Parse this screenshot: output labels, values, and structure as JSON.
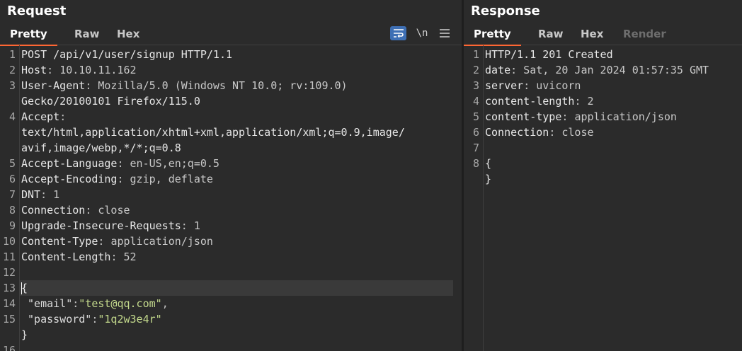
{
  "request": {
    "title": "Request",
    "tabs": [
      "Pretty",
      "Raw",
      "Hex"
    ],
    "active_tab": "Pretty",
    "toolbar": {
      "newline_label": "\\n",
      "wrap_icon": "wrap-lines-icon",
      "menu_icon": "menu-icon"
    },
    "lines": [
      {
        "n": "1",
        "text": "POST /api/v1/user/signup HTTP/1.1"
      },
      {
        "n": "2",
        "key": "Host",
        "value": "10.10.11.162"
      },
      {
        "n": "3",
        "key": "User-Agent",
        "value": "Mozilla/5.0 (Windows NT 10.0; rv:109.0)"
      },
      {
        "n": "",
        "text": "Gecko/20100101 Firefox/115.0"
      },
      {
        "n": "4",
        "key": "Accept",
        "value": ""
      },
      {
        "n": "",
        "text": "text/html,application/xhtml+xml,application/xml;q=0.9,image/"
      },
      {
        "n": "",
        "text": "avif,image/webp,*/*;q=0.8"
      },
      {
        "n": "5",
        "key": "Accept-Language",
        "value": "en-US,en;q=0.5"
      },
      {
        "n": "6",
        "key": "Accept-Encoding",
        "value": "gzip, deflate"
      },
      {
        "n": "7",
        "key": "DNT",
        "value": "1"
      },
      {
        "n": "8",
        "key": "Connection",
        "value": "close"
      },
      {
        "n": "9",
        "key": "Upgrade-Insecure-Requests",
        "value": "1"
      },
      {
        "n": "10",
        "key": "Content-Type",
        "value": "application/json"
      },
      {
        "n": "11",
        "key": "Content-Length",
        "value": "52"
      },
      {
        "n": "12",
        "text": ""
      },
      {
        "n": "13",
        "text": "{",
        "highlight": true
      },
      {
        "n": "14",
        "json_key": "\"email\"",
        "json_value": "\"test@qq.com\"",
        "trail": ","
      },
      {
        "n": "15",
        "json_key": "\"password\"",
        "json_value": "\"1q2w3e4r\"",
        "trail": ""
      },
      {
        "n": "",
        "text": "}"
      },
      {
        "n": "16",
        "text": ""
      }
    ]
  },
  "response": {
    "title": "Response",
    "tabs": [
      "Pretty",
      "Raw",
      "Hex",
      "Render"
    ],
    "active_tab": "Pretty",
    "disabled_tab": "Render",
    "lines": [
      {
        "n": "1",
        "text": "HTTP/1.1 201 Created"
      },
      {
        "n": "2",
        "key": "date",
        "value": "Sat, 20 Jan 2024 01:57:35 GMT"
      },
      {
        "n": "3",
        "key": "server",
        "value": "uvicorn"
      },
      {
        "n": "4",
        "key": "content-length",
        "value": "2"
      },
      {
        "n": "5",
        "key": "content-type",
        "value": "application/json"
      },
      {
        "n": "6",
        "key": "Connection",
        "value": "close"
      },
      {
        "n": "7",
        "text": ""
      },
      {
        "n": "8",
        "text": "{"
      },
      {
        "n": "",
        "text": "}"
      }
    ]
  },
  "colors": {
    "accent": "#ff6633",
    "background": "#2b2b2b",
    "json_string": "#c3d98c",
    "wrap_button": "#3e6fb4"
  }
}
